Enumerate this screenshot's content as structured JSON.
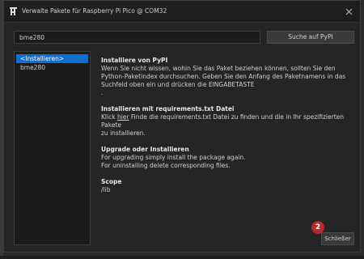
{
  "window": {
    "title": "Verwalte Pakete für Raspberry Pi Pico @ COM32",
    "close_glyph": "✕"
  },
  "search": {
    "value": "bme280",
    "button_label": "Suche auf PyPI"
  },
  "package_list": {
    "items": [
      "<Installieren>",
      "bme280"
    ],
    "selected_index": 0
  },
  "info": {
    "pypi": {
      "heading": "Installiere von PyPI",
      "lines": [
        "Wenn Sie nicht wissen, wohin Sie das Paket beziehen können, sollten Sie den",
        "Python-Paketindex durchsuchen. Geben Sie den Anfang des Paketnamens in das",
        "Suchfeld oben ein und drücken die EINGABETASTE",
        "."
      ]
    },
    "requirements": {
      "heading": "Installieren mit requirements.txt Datei",
      "line1_pre": "Klick ",
      "line1_link": "hier",
      "line1_post": " Finde die requirements.txt Datei zu finden und die in Ihr spezifizierten Pakete",
      "line2": "zu installieren."
    },
    "upgrade": {
      "heading": "Upgrade oder Installieren",
      "lines": [
        "For upgrading simply install the package again.",
        "For uninstalling delete corresponding files."
      ]
    },
    "scope": {
      "heading": "Scope",
      "value": "/lib"
    }
  },
  "footer": {
    "close_label": "Schließer",
    "step_badge": "2"
  },
  "colors": {
    "selection": "#0f6fcf",
    "badge": "#b52a2a"
  }
}
